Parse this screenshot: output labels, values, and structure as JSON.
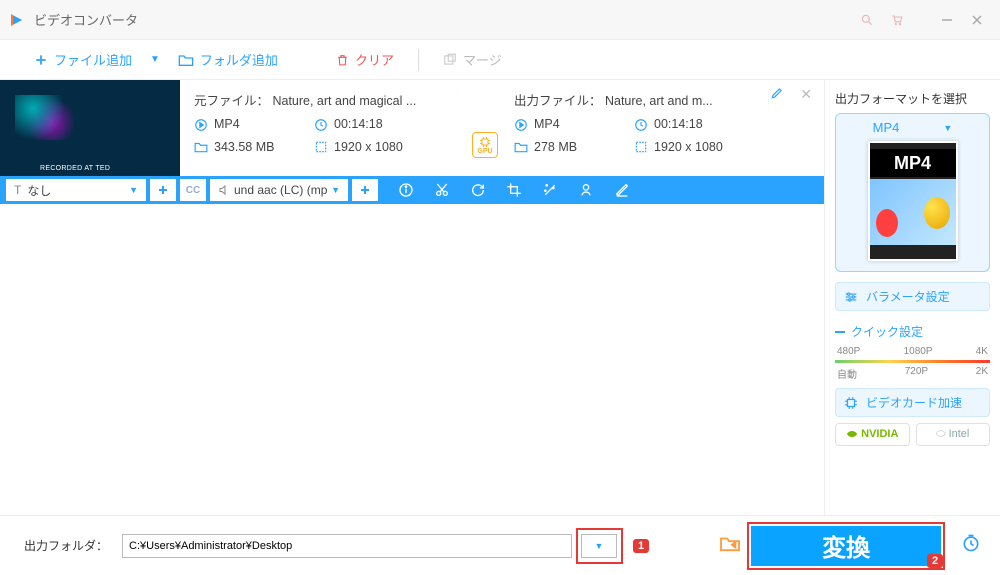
{
  "title": "ビデオコンバータ",
  "toolbar": {
    "add_file": "ファイル追加",
    "add_folder": "フォルダ追加",
    "clear": "クリア",
    "merge": "マージ"
  },
  "file": {
    "thumb_tag": "RECORDED AT TED",
    "src_label": "元ファイル： Nature, art and magical ...",
    "out_label": "出力ファイル： Nature, art and m...",
    "src": {
      "format": "MP4",
      "duration": "00:14:18",
      "size": "343.58 MB",
      "resolution": "1920 x 1080"
    },
    "out": {
      "format": "MP4",
      "duration": "00:14:18",
      "size": "278 MB",
      "resolution": "1920 x 1080"
    },
    "gpu_chip": "GPU",
    "subtitle_select": "なし",
    "audio_select": "und aac (LC) (mp"
  },
  "sidebar": {
    "title": "出力フォーマットを選択",
    "format": "MP4",
    "param_settings": "バラメータ設定",
    "quick_title": "クイック設定",
    "quality_top": [
      "480P",
      "1080P",
      "4K"
    ],
    "quality_bot": [
      "自動",
      "720P",
      "2K"
    ],
    "gpu_accel": "ビデオカード加速",
    "nvidia": "NVIDIA",
    "intel": "Intel"
  },
  "bottom": {
    "label": "出力フォルダ：",
    "path": "C:¥Users¥Administrator¥Desktop",
    "marker1": "1",
    "marker2": "2",
    "convert": "変換"
  }
}
